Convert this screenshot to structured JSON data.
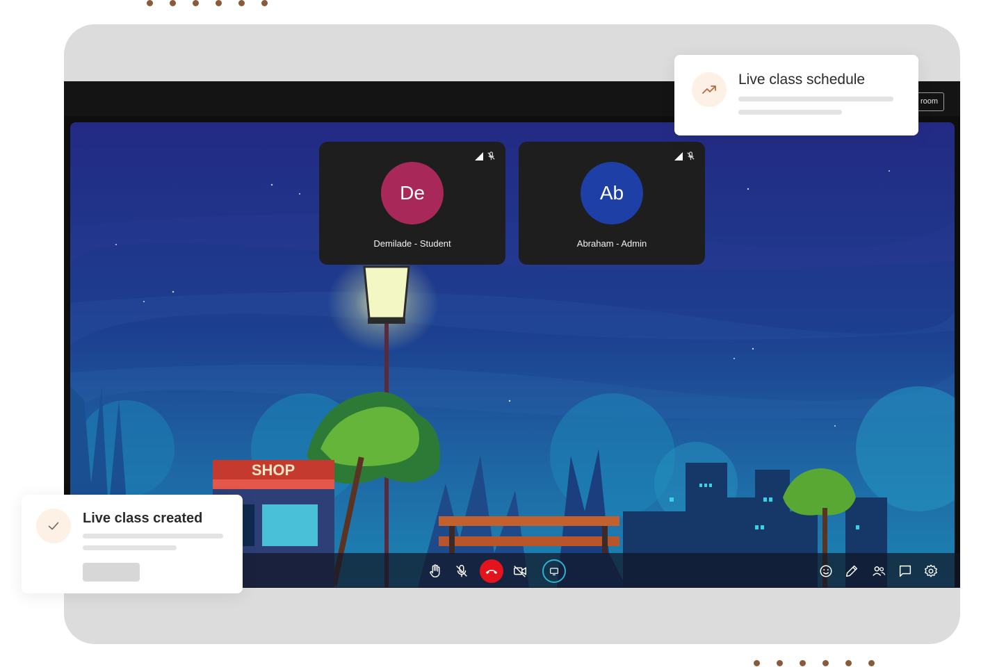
{
  "decor": {
    "top_dots": 6,
    "bottom_dots": 6,
    "dot_color": "#8a5a3c"
  },
  "header": {
    "room_button_label": "room"
  },
  "participants": [
    {
      "initials": "De",
      "name": "Demilade - Student",
      "color": "#a9285a",
      "muted": true
    },
    {
      "initials": "Ab",
      "name": "Abraham - Admin",
      "color": "#1d3fa6",
      "muted": true
    }
  ],
  "scene": {
    "shop_sign": "SHOP"
  },
  "controls": {
    "center": [
      "raise-hand-icon",
      "mic-off-icon",
      "end-call-icon",
      "camera-off-icon",
      "screen-share-icon"
    ],
    "right": [
      "emoji-icon",
      "pencil-icon",
      "participants-icon",
      "chat-icon",
      "settings-icon"
    ],
    "end_call_color": "#e3141b",
    "share_accent": "#2bb3cf"
  },
  "notifications": {
    "schedule": {
      "title": "Live class schedule",
      "icon": "trend-up-icon"
    },
    "created": {
      "title": "Live class created",
      "icon": "check-icon"
    }
  }
}
